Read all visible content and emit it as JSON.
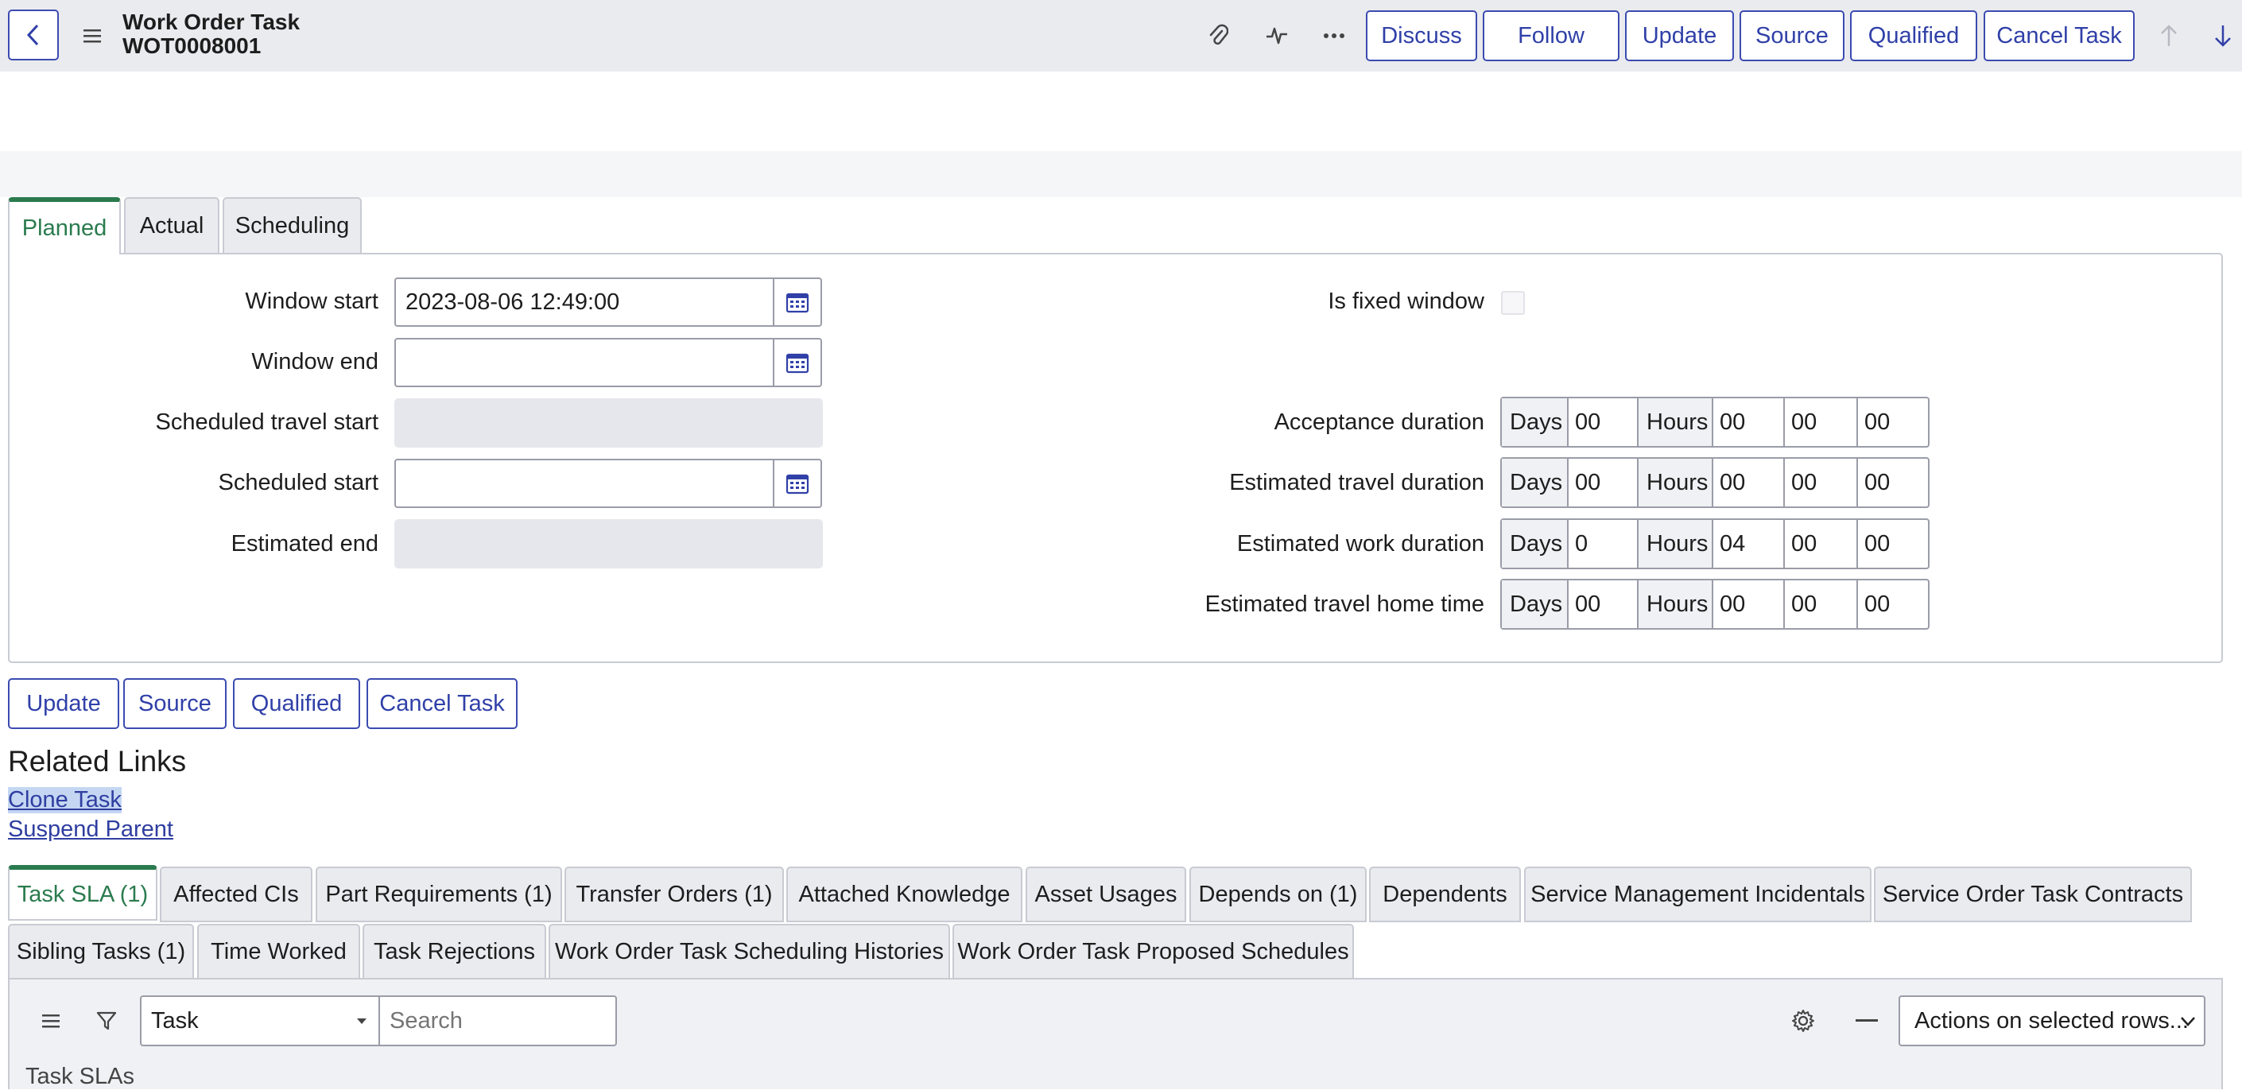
{
  "header": {
    "title": "Work Order Task",
    "number": "WOT0008001",
    "buttons": [
      "Discuss",
      "Follow",
      "Update",
      "Source",
      "Qualified",
      "Cancel Task"
    ],
    "icons": [
      "back-icon",
      "menu-icon",
      "paperclip-icon",
      "activity-icon",
      "more-icon",
      "arrow-up-icon",
      "arrow-down-icon"
    ]
  },
  "tabs": [
    "Planned",
    "Actual",
    "Scheduling"
  ],
  "planned": {
    "window_start": {
      "label": "Window start",
      "value": "2023-08-06 12:49:00"
    },
    "window_end": {
      "label": "Window end",
      "value": ""
    },
    "scheduled_travel_start": {
      "label": "Scheduled travel start"
    },
    "scheduled_start": {
      "label": "Scheduled start",
      "value": ""
    },
    "estimated_end": {
      "label": "Estimated end"
    },
    "is_fixed_window": {
      "label": "Is fixed window",
      "checked": false
    },
    "durations": [
      {
        "label": "Acceptance duration",
        "days_label": "Days",
        "days": "00",
        "hours_label": "Hours",
        "hours": "00",
        "minutes": "00",
        "seconds": "00"
      },
      {
        "label": "Estimated travel duration",
        "days_label": "Days",
        "days": "00",
        "hours_label": "Hours",
        "hours": "00",
        "minutes": "00",
        "seconds": "00"
      },
      {
        "label": "Estimated work duration",
        "days_label": "Days",
        "days": "0",
        "hours_label": "Hours",
        "hours": "04",
        "minutes": "00",
        "seconds": "00"
      },
      {
        "label": "Estimated travel home time",
        "days_label": "Days",
        "days": "00",
        "hours_label": "Hours",
        "hours": "00",
        "minutes": "00",
        "seconds": "00"
      }
    ]
  },
  "form_buttons": [
    "Update",
    "Source",
    "Qualified",
    "Cancel Task"
  ],
  "related_links": {
    "title": "Related Links",
    "links": [
      "Clone Task",
      "Suspend Parent"
    ]
  },
  "related_tabs_row1": [
    "Task SLA (1)",
    "Affected CIs",
    "Part Requirements (1)",
    "Transfer Orders (1)",
    "Attached Knowledge",
    "Asset Usages",
    "Depends on (1)",
    "Dependents",
    "Service Management Incidentals",
    "Service Order Task Contracts"
  ],
  "related_tabs_row2": [
    "Sibling Tasks (1)",
    "Time Worked",
    "Task Rejections",
    "Work Order Task Scheduling Histories",
    "Work Order Task Proposed Schedules"
  ],
  "list_toolbar": {
    "field_select": "Task",
    "search_placeholder": "Search",
    "actions_select": "Actions on selected rows...",
    "list_title": "Task SLAs"
  },
  "colors": {
    "accent_green": "#2a7b4e",
    "button_blue": "#3040a8",
    "header_bg": "#eaebef"
  }
}
